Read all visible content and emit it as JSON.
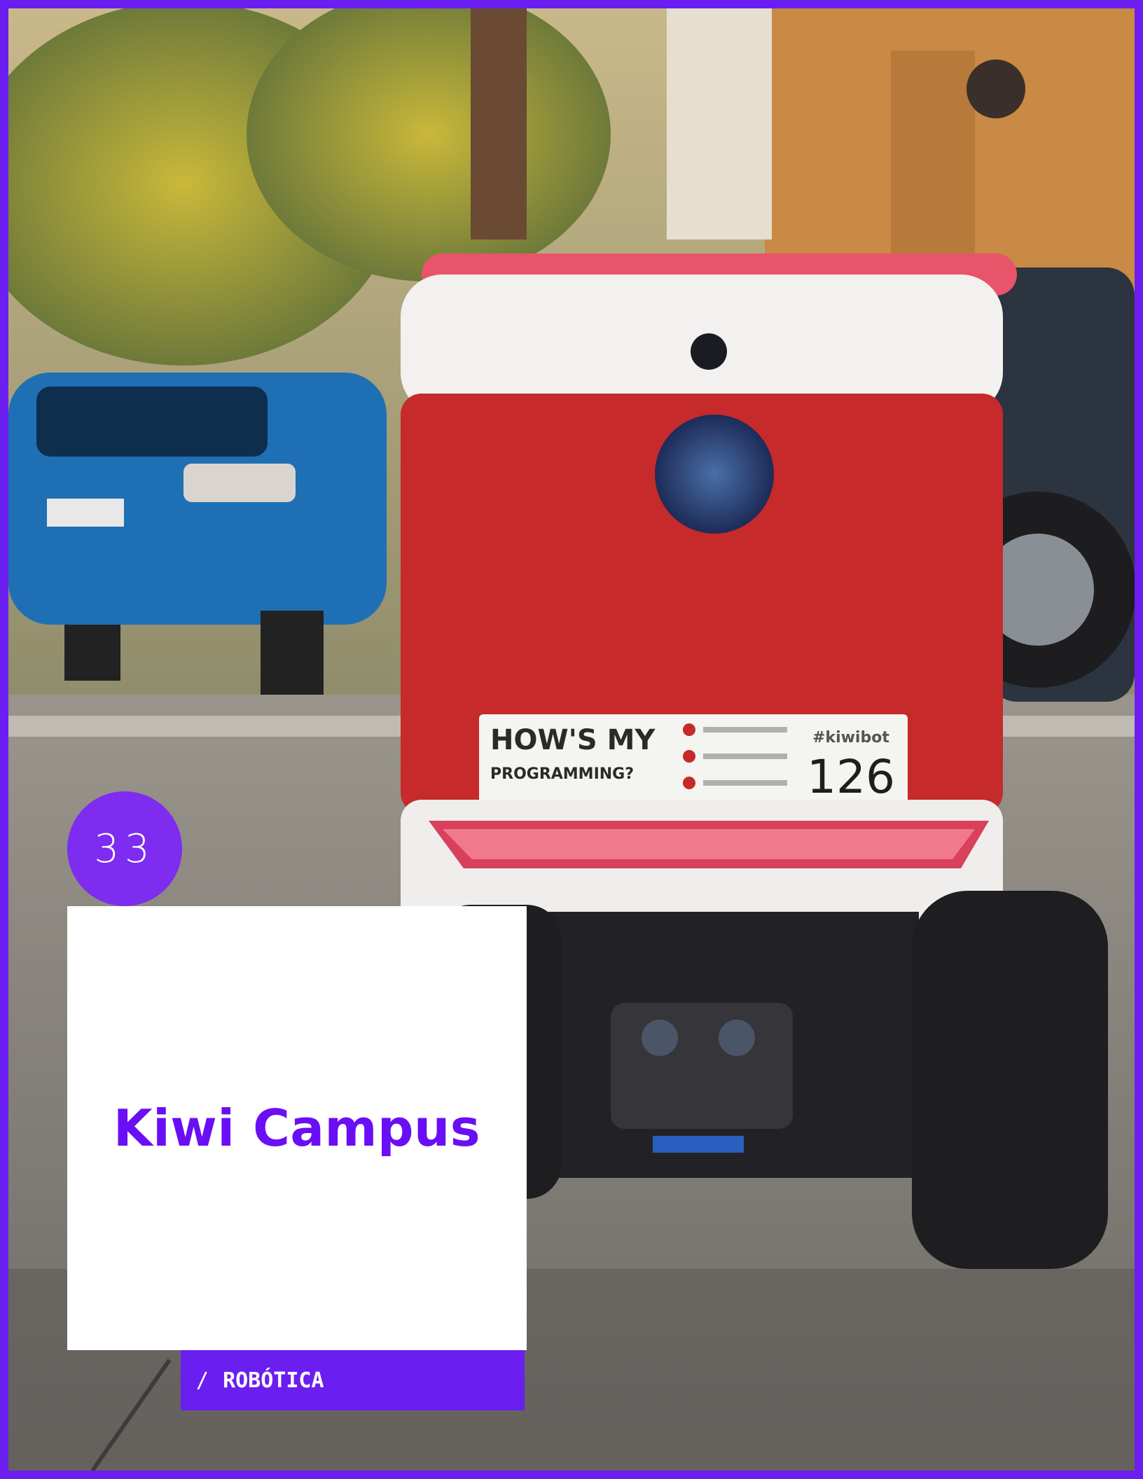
{
  "page_number": "33",
  "title": "Kiwi Campus",
  "category": {
    "separator": "/",
    "label": "ROBÓTICA"
  },
  "photo": {
    "subject": "delivery-robot",
    "sticker_headline": "HOW'S MY",
    "sticker_subline": "PROGRAMMING?",
    "brand_tag": "#kiwibot",
    "robot_number": "126"
  },
  "colors": {
    "accent": "#6a1ff0",
    "title": "#6a0ef5",
    "badge": "#7d2cf0",
    "robot_red": "#c62a2a"
  }
}
